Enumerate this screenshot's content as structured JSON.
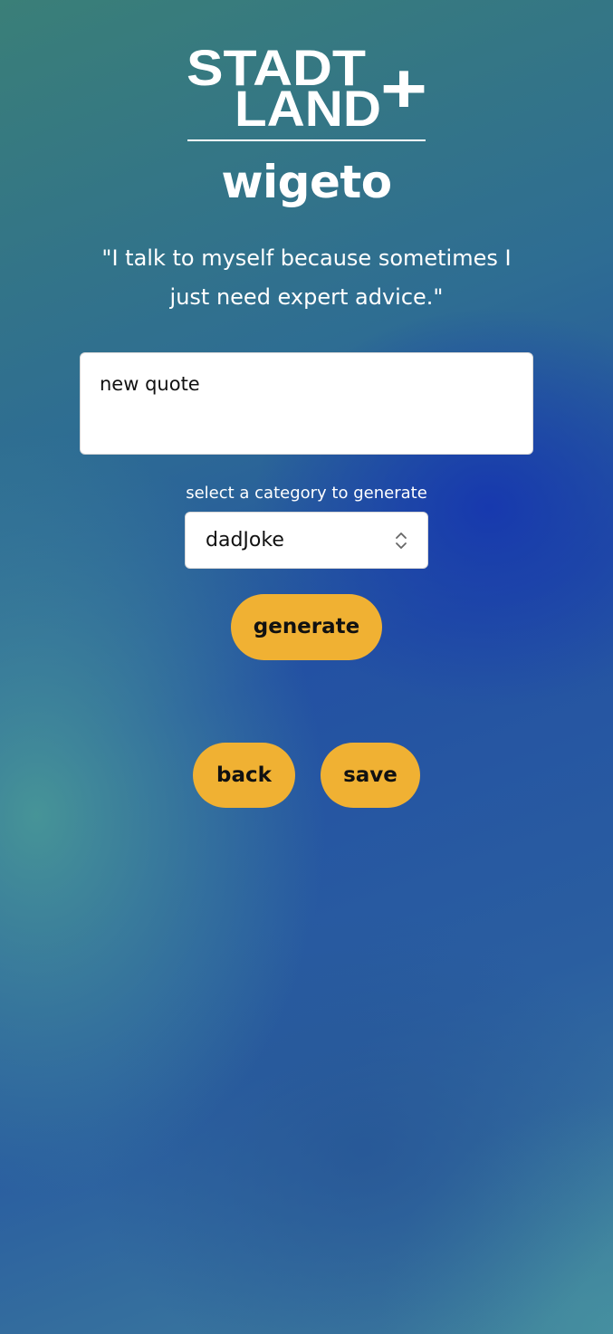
{
  "logo": {
    "line1": "STADT",
    "line2": "LAND",
    "plus": "+"
  },
  "brand": {
    "name": "wigeto"
  },
  "quote": {
    "text": "\"I talk to myself because sometimes I just need expert advice.\""
  },
  "editor": {
    "placeholder": "new quote",
    "value": ""
  },
  "category": {
    "label": "select a category to generate",
    "selected": "dadJoke"
  },
  "buttons": {
    "generate": "generate",
    "back": "back",
    "save": "save"
  },
  "colors": {
    "button": "#f0b133",
    "text": "#ffffff"
  },
  "icons": {
    "select_arrows": "chevron-up-down-icon"
  }
}
